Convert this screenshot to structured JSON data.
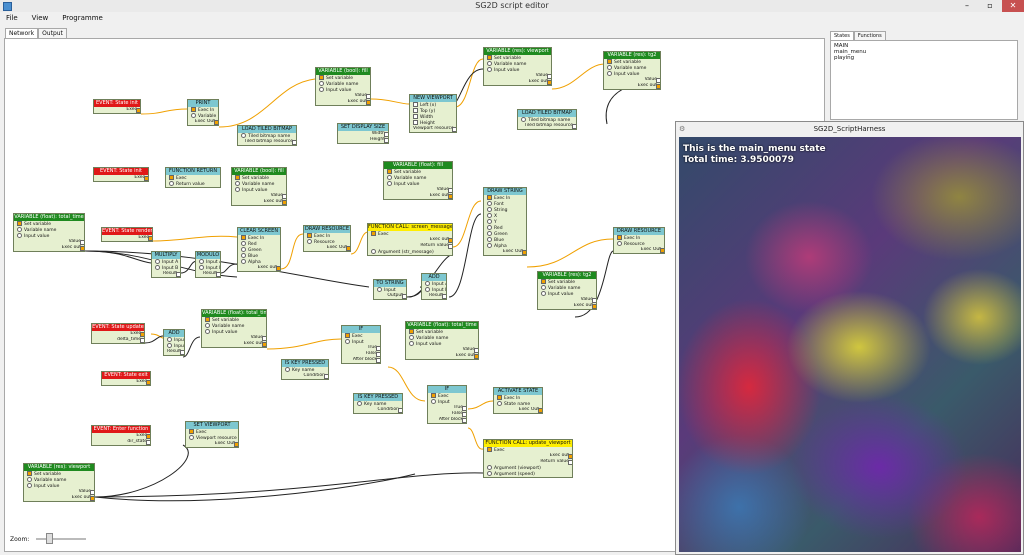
{
  "window": {
    "title": "SG2D script editor"
  },
  "menu": [
    "File",
    "View",
    "Programme"
  ],
  "tabs": [
    "Network",
    "Output"
  ],
  "zoom_label": "Zoom:",
  "right_panel": {
    "tabs": [
      "States",
      "Functions"
    ],
    "states": [
      "MAIN",
      "main_menu",
      "playing"
    ]
  },
  "harness": {
    "title": "SG2D_ScriptHarness",
    "line1": "This is the main_menu state",
    "line2": "Total time: 3.9500079"
  },
  "nodes": [
    {
      "id": "ev1",
      "title": "EVENT: State init",
      "type": "ev",
      "rows": [
        {
          "t": "Exec",
          "side": "r"
        }
      ]
    },
    {
      "id": "print",
      "title": "PRINT",
      "type": "cyan",
      "rows": [
        {
          "t": "Exec In"
        },
        {
          "t": "Variable",
          "pin": "o"
        },
        {
          "t": "Exec Out",
          "side": "r"
        }
      ]
    },
    {
      "id": "var1",
      "title": "VARIABLE (bool): fill",
      "type": "var",
      "rows": [
        {
          "t": "Set variable"
        },
        {
          "t": "Variable name",
          "pin": "o"
        },
        {
          "t": "Input value",
          "pin": "o"
        },
        {
          "t": "Value",
          "side": "r"
        },
        {
          "t": "Exec out",
          "side": "r"
        }
      ]
    },
    {
      "id": "loadtb1",
      "title": "LOAD TILED BITMAP",
      "type": "cyan",
      "rows": [
        {
          "t": "Tiled bitmap name",
          "pin": "o"
        },
        {
          "t": "Tiled bitmap resource",
          "side": "r"
        }
      ]
    },
    {
      "id": "newvp",
      "title": "NEW VIEWPORT",
      "type": "cyan",
      "rows": [
        {
          "t": "Left (x)"
        },
        {
          "t": "Top (y)"
        },
        {
          "t": "Width"
        },
        {
          "t": "Height"
        },
        {
          "t": "Viewport resource",
          "side": "r"
        }
      ]
    },
    {
      "id": "setdisp",
      "title": "SET DISPLAY SIZE",
      "type": "cyan",
      "rows": [
        {
          "t": "Width",
          "side": "r"
        },
        {
          "t": "Height",
          "side": "r"
        }
      ]
    },
    {
      "id": "varvp",
      "title": "VARIABLE (res): viewport",
      "type": "var",
      "rows": [
        {
          "t": "Set variable"
        },
        {
          "t": "Variable name",
          "pin": "o"
        },
        {
          "t": "Input value",
          "pin": "o"
        },
        {
          "t": "Value",
          "side": "r"
        },
        {
          "t": "Exec out",
          "side": "r"
        }
      ]
    },
    {
      "id": "vartg",
      "title": "VARIABLE (res): tg2",
      "type": "var",
      "rows": [
        {
          "t": "Set variable"
        },
        {
          "t": "Variable name",
          "pin": "o"
        },
        {
          "t": "Input value",
          "pin": "o"
        },
        {
          "t": "Value",
          "side": "r"
        },
        {
          "t": "Exec out",
          "side": "r"
        }
      ]
    },
    {
      "id": "loadtb2",
      "title": "LOAD TILED BITMAP",
      "type": "cyan",
      "rows": [
        {
          "t": "Tiled bitmap name",
          "pin": "o"
        },
        {
          "t": "Tiled bitmap resource",
          "side": "r"
        }
      ]
    },
    {
      "id": "ev2",
      "title": "EVENT: State init",
      "type": "ev",
      "rows": [
        {
          "t": "Exec",
          "side": "r"
        }
      ]
    },
    {
      "id": "fnret",
      "title": "FUNCTION RETURN",
      "type": "cyan",
      "rows": [
        {
          "t": "Exec"
        },
        {
          "t": "Return value",
          "pin": "o"
        }
      ]
    },
    {
      "id": "var3",
      "title": "VARIABLE (bool): fill",
      "type": "var",
      "rows": [
        {
          "t": "Set variable"
        },
        {
          "t": "Variable name",
          "pin": "o"
        },
        {
          "t": "Input value",
          "pin": "o"
        },
        {
          "t": "Value",
          "side": "r"
        },
        {
          "t": "Exec out",
          "side": "r"
        }
      ]
    },
    {
      "id": "var4",
      "title": "VARIABLE (float): fill",
      "type": "var",
      "rows": [
        {
          "t": "Set variable"
        },
        {
          "t": "Variable name",
          "pin": "o"
        },
        {
          "t": "Input value",
          "pin": "o"
        },
        {
          "t": "Value",
          "side": "r"
        },
        {
          "t": "Exec out",
          "side": "r"
        }
      ]
    },
    {
      "id": "vartt",
      "title": "VARIABLE (float): total_time",
      "type": "var",
      "rows": [
        {
          "t": "Set variable"
        },
        {
          "t": "Variable name",
          "pin": "o"
        },
        {
          "t": "Input value",
          "pin": "o"
        },
        {
          "t": "Value",
          "side": "r"
        },
        {
          "t": "Exec out",
          "side": "r"
        }
      ]
    },
    {
      "id": "ev3",
      "title": "EVENT: State render",
      "type": "ev",
      "rows": [
        {
          "t": "Exec",
          "side": "r"
        }
      ]
    },
    {
      "id": "clear",
      "title": "CLEAR SCREEN",
      "type": "cyan",
      "rows": [
        {
          "t": "Exec In"
        },
        {
          "t": "Red",
          "pin": "o"
        },
        {
          "t": "Green",
          "pin": "o"
        },
        {
          "t": "Blue",
          "pin": "o"
        },
        {
          "t": "Alpha",
          "pin": "o"
        },
        {
          "t": "Exec out",
          "side": "r"
        }
      ]
    },
    {
      "id": "mult",
      "title": "MULTIPLY",
      "type": "cyan",
      "rows": [
        {
          "t": "Input A",
          "pin": "o"
        },
        {
          "t": "Input B",
          "pin": "o"
        },
        {
          "t": "Result",
          "side": "r"
        }
      ]
    },
    {
      "id": "modulo",
      "title": "MODULO",
      "type": "cyan",
      "rows": [
        {
          "t": "Input A",
          "pin": "o"
        },
        {
          "t": "Input B",
          "pin": "o"
        },
        {
          "t": "Result",
          "side": "r"
        }
      ]
    },
    {
      "id": "drawres1",
      "title": "DRAW RESOURCE",
      "type": "cyan",
      "rows": [
        {
          "t": "Exec In"
        },
        {
          "t": "Resource",
          "pin": "o"
        },
        {
          "t": "Exec Out",
          "side": "r"
        }
      ]
    },
    {
      "id": "fncall1",
      "title": "FUNCTION CALL: screen_message",
      "type": "fn",
      "rows": [
        {
          "t": "Exec"
        },
        {
          "t": "Exec out",
          "side": "r"
        },
        {
          "t": "Return value",
          "side": "r"
        },
        {
          "t": "Argument (str_message)",
          "pin": "o"
        }
      ]
    },
    {
      "id": "drawstr",
      "title": "DRAW STRING",
      "type": "cyan",
      "rows": [
        {
          "t": "Exec In"
        },
        {
          "t": "Font",
          "pin": "o"
        },
        {
          "t": "String",
          "pin": "o"
        },
        {
          "t": "X",
          "pin": "o"
        },
        {
          "t": "Y",
          "pin": "o"
        },
        {
          "t": "Red",
          "pin": "o"
        },
        {
          "t": "Green",
          "pin": "o"
        },
        {
          "t": "Blue",
          "pin": "o"
        },
        {
          "t": "Alpha",
          "pin": "o"
        },
        {
          "t": "Exec Out",
          "side": "r"
        }
      ]
    },
    {
      "id": "drawres2",
      "title": "DRAW RESOURCE",
      "type": "cyan",
      "rows": [
        {
          "t": "Exec In"
        },
        {
          "t": "Resource",
          "pin": "o"
        },
        {
          "t": "Exec Out",
          "side": "r"
        }
      ]
    },
    {
      "id": "tostr",
      "title": "TO STRING",
      "type": "cyan",
      "rows": [
        {
          "t": "Input",
          "pin": "o"
        },
        {
          "t": "Output",
          "side": "r"
        }
      ]
    },
    {
      "id": "add1",
      "title": "ADD",
      "type": "cyan",
      "rows": [
        {
          "t": "Input A",
          "pin": "o"
        },
        {
          "t": "Input B",
          "pin": "o"
        },
        {
          "t": "Result",
          "side": "r"
        }
      ]
    },
    {
      "id": "vartg2",
      "title": "VARIABLE (res): tg2",
      "type": "var",
      "rows": [
        {
          "t": "Set variable"
        },
        {
          "t": "Variable name",
          "pin": "o"
        },
        {
          "t": "Input value",
          "pin": "o"
        },
        {
          "t": "Value",
          "side": "r"
        },
        {
          "t": "Exec out",
          "side": "r"
        }
      ]
    },
    {
      "id": "ev4",
      "title": "EVENT: State update",
      "type": "ev",
      "rows": [
        {
          "t": "Exec",
          "side": "r"
        },
        {
          "t": "delta_time",
          "side": "r"
        }
      ]
    },
    {
      "id": "add2",
      "title": "ADD",
      "type": "cyan",
      "rows": [
        {
          "t": "Input A",
          "pin": "o"
        },
        {
          "t": "Input B",
          "pin": "o"
        },
        {
          "t": "Result",
          "side": "r"
        }
      ]
    },
    {
      "id": "vartt2",
      "title": "VARIABLE (float): total_time",
      "type": "var",
      "rows": [
        {
          "t": "Set variable"
        },
        {
          "t": "Variable name",
          "pin": "o"
        },
        {
          "t": "Input value",
          "pin": "o"
        },
        {
          "t": "Value",
          "side": "r"
        },
        {
          "t": "Exec out",
          "side": "r"
        }
      ]
    },
    {
      "id": "if1",
      "title": "IF",
      "type": "cyan",
      "rows": [
        {
          "t": "Exec"
        },
        {
          "t": "Input",
          "pin": "o"
        },
        {
          "t": "True",
          "side": "r"
        },
        {
          "t": "False",
          "side": "r"
        },
        {
          "t": "After block",
          "side": "r"
        }
      ]
    },
    {
      "id": "vartt3",
      "title": "VARIABLE (float): total_time",
      "type": "var",
      "rows": [
        {
          "t": "Set variable"
        },
        {
          "t": "Variable name",
          "pin": "o"
        },
        {
          "t": "Input value",
          "pin": "o"
        },
        {
          "t": "Value",
          "side": "r"
        },
        {
          "t": "Exec out",
          "side": "r"
        }
      ]
    },
    {
      "id": "keyp1",
      "title": "IS KEY PRESSED",
      "type": "cyan",
      "rows": [
        {
          "t": "Key name",
          "pin": "o"
        },
        {
          "t": "Condition",
          "side": "r"
        }
      ]
    },
    {
      "id": "ev5",
      "title": "EVENT: State exit",
      "type": "ev",
      "rows": [
        {
          "t": "Exec",
          "side": "r"
        }
      ]
    },
    {
      "id": "keyp2",
      "title": "IS KEY PRESSED",
      "type": "cyan",
      "rows": [
        {
          "t": "Key name",
          "pin": "o"
        },
        {
          "t": "Condition",
          "side": "r"
        }
      ]
    },
    {
      "id": "if2",
      "title": "IF",
      "type": "cyan",
      "rows": [
        {
          "t": "Exec"
        },
        {
          "t": "Input",
          "pin": "o"
        },
        {
          "t": "True",
          "side": "r"
        },
        {
          "t": "False",
          "side": "r"
        },
        {
          "t": "After block",
          "side": "r"
        }
      ]
    },
    {
      "id": "actstate",
      "title": "ACTIVATE STATE",
      "type": "cyan",
      "rows": [
        {
          "t": "Exec In"
        },
        {
          "t": "State name",
          "pin": "o"
        },
        {
          "t": "Exec Out",
          "side": "r"
        }
      ]
    },
    {
      "id": "fncall2",
      "title": "FUNCTION CALL: update_viewport",
      "type": "fn",
      "rows": [
        {
          "t": "Exec"
        },
        {
          "t": "Exec out",
          "side": "r"
        },
        {
          "t": "Return value",
          "side": "r"
        },
        {
          "t": "Argument (viewport)",
          "pin": "o"
        },
        {
          "t": "Argument (speed)",
          "pin": "o"
        }
      ]
    },
    {
      "id": "ev6",
      "title": "EVENT: Enter function",
      "type": "ev",
      "rows": [
        {
          "t": "Exec",
          "side": "r"
        },
        {
          "t": "dir_state",
          "side": "r"
        }
      ]
    },
    {
      "id": "setvp",
      "title": "SET VIEWPORT",
      "type": "cyan",
      "rows": [
        {
          "t": "Exec"
        },
        {
          "t": "Viewport resource",
          "pin": "o"
        },
        {
          "t": "Exec Out",
          "side": "r"
        }
      ]
    },
    {
      "id": "varvp2",
      "title": "VARIABLE (res): viewport",
      "type": "var",
      "rows": [
        {
          "t": "Set variable"
        },
        {
          "t": "Variable name",
          "pin": "o"
        },
        {
          "t": "Input value",
          "pin": "o"
        },
        {
          "t": "Value",
          "side": "r"
        },
        {
          "t": "Exec out",
          "side": "r"
        }
      ]
    }
  ]
}
